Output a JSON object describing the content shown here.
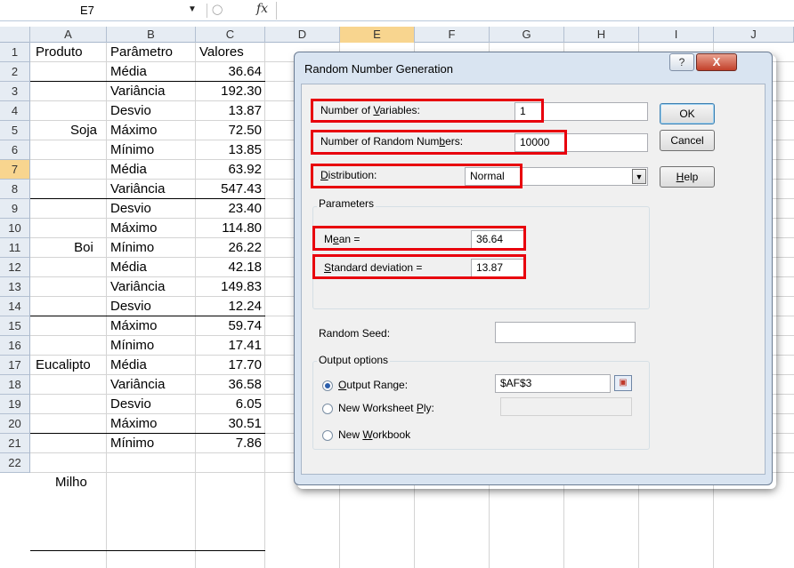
{
  "formula_bar": {
    "name_box": "E7",
    "fx": "fx"
  },
  "columns": [
    "A",
    "B",
    "C",
    "D",
    "E",
    "F",
    "G",
    "H",
    "I",
    "J"
  ],
  "rows": [
    "1",
    "2",
    "3",
    "4",
    "5",
    "6",
    "7",
    "8",
    "9",
    "10",
    "11",
    "12",
    "13",
    "14",
    "15",
    "16",
    "17",
    "18",
    "19",
    "20",
    "21",
    "22"
  ],
  "table": {
    "headers": [
      "Produto",
      "Parâmetro",
      "Valores"
    ],
    "params": [
      "Média",
      "Variância",
      "Desvio",
      "Máximo",
      "Mínimo",
      "Média",
      "Variância",
      "Desvio",
      "Máximo",
      "Mínimo",
      "Média",
      "Variância",
      "Desvio",
      "Máximo",
      "Mínimo",
      "Média",
      "Variância",
      "Desvio",
      "Máximo",
      "Mínimo"
    ],
    "values": [
      "36.64",
      "192.30",
      "13.87",
      "72.50",
      "13.85",
      "63.92",
      "547.43",
      "23.40",
      "114.80",
      "26.22",
      "42.18",
      "149.83",
      "12.24",
      "59.74",
      "17.41",
      "17.70",
      "36.58",
      "6.05",
      "30.51",
      "7.86"
    ],
    "products": [
      "Soja",
      "Boi",
      "Eucalipto",
      "Milho"
    ]
  },
  "dialog": {
    "title": "Random Number Generation",
    "help_glyph": "?",
    "close_glyph": "X",
    "num_variables_label": "Number of Variables:",
    "num_variables_value": "1",
    "num_random_label": "Number of Random Numbers:",
    "num_random_value": "10000",
    "distribution_label": "Distribution:",
    "distribution_value": "Normal",
    "parameters_label": "Parameters",
    "mean_label": "Mean =",
    "mean_value": "36.64",
    "std_label": "Standard deviation =",
    "std_value": "13.87",
    "random_seed_label": "Random Seed:",
    "random_seed_value": "",
    "output_options_label": "Output options",
    "output_range_label": "Output Range:",
    "output_range_value": "$AF$3",
    "new_worksheet_label": "New Worksheet Ply:",
    "new_workbook_label": "New Workbook",
    "ok_label": "OK",
    "cancel_label": "Cancel",
    "help_label": "Help"
  },
  "colors": {
    "highlight": "#e8000d",
    "selected_header": "#f8d58f"
  }
}
